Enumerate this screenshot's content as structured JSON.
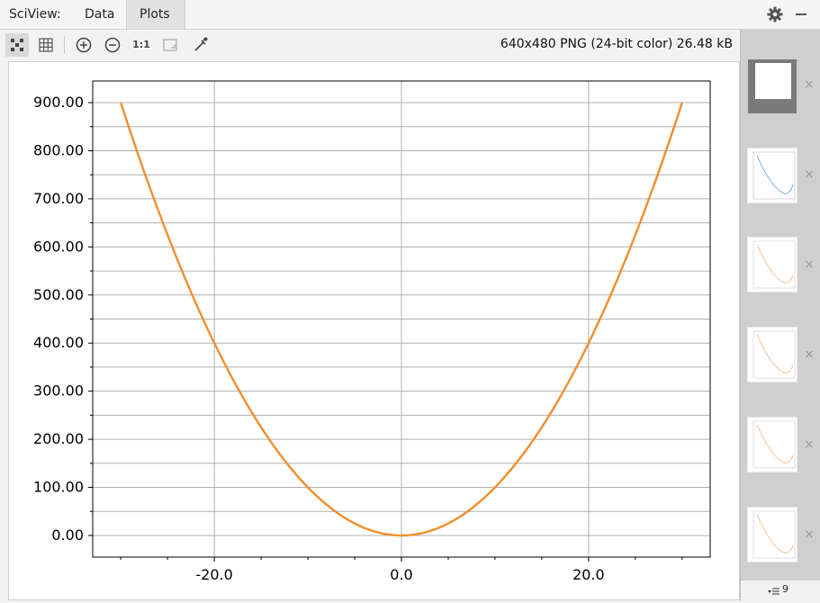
{
  "app": {
    "tool_label": "SciView:",
    "tabs": [
      {
        "label": "Data"
      },
      {
        "label": "Plots",
        "active": true
      }
    ]
  },
  "toolbar": {
    "buttons": [
      {
        "icon": "fit-icon",
        "active": true
      },
      {
        "icon": "grid-icon"
      },
      {
        "icon": "zoom-in-icon"
      },
      {
        "icon": "zoom-out-icon"
      },
      {
        "icon": "actual-size-icon",
        "label": "1:1"
      },
      {
        "icon": "fit-to-window-icon"
      },
      {
        "icon": "color-picker-icon"
      }
    ],
    "image_info": "640x480 PNG (24-bit color) 26.48 kB"
  },
  "sidebar": {
    "thumbnail_count": "9",
    "thumbnails": [
      {
        "name": "blank-plot-thumbnail",
        "selected": true
      },
      {
        "name": "blue-curve-thumbnail"
      },
      {
        "name": "orange-curve-thumbnail"
      },
      {
        "name": "orange-curve-thumbnail"
      },
      {
        "name": "orange-curve-thumbnail"
      },
      {
        "name": "orange-curve-thumbnail"
      }
    ]
  },
  "chart_data": {
    "type": "line",
    "function": "y = x^2",
    "x_range": [
      -30,
      30
    ],
    "xlim": [
      -33,
      33
    ],
    "ylim": [
      -45,
      945
    ],
    "x_ticks": [
      -20,
      0,
      20
    ],
    "x_tick_labels": [
      "-20.0",
      "0.0",
      "20.0"
    ],
    "y_ticks": [
      0,
      100,
      200,
      300,
      400,
      500,
      600,
      700,
      800,
      900
    ],
    "y_tick_labels": [
      "0.00",
      "100.00",
      "200.00",
      "300.00",
      "400.00",
      "500.00",
      "600.00",
      "700.00",
      "800.00",
      "900.00"
    ],
    "grid": true,
    "series": [
      {
        "color": "#f28e2b",
        "points": [
          [
            -30,
            900
          ],
          [
            -25,
            625
          ],
          [
            -20,
            400
          ],
          [
            -15,
            225
          ],
          [
            -10,
            100
          ],
          [
            -5,
            25
          ],
          [
            0,
            0
          ],
          [
            5,
            25
          ],
          [
            10,
            100
          ],
          [
            15,
            225
          ],
          [
            20,
            400
          ],
          [
            25,
            625
          ],
          [
            30,
            900
          ]
        ]
      }
    ],
    "title": "",
    "xlabel": "",
    "ylabel": ""
  }
}
